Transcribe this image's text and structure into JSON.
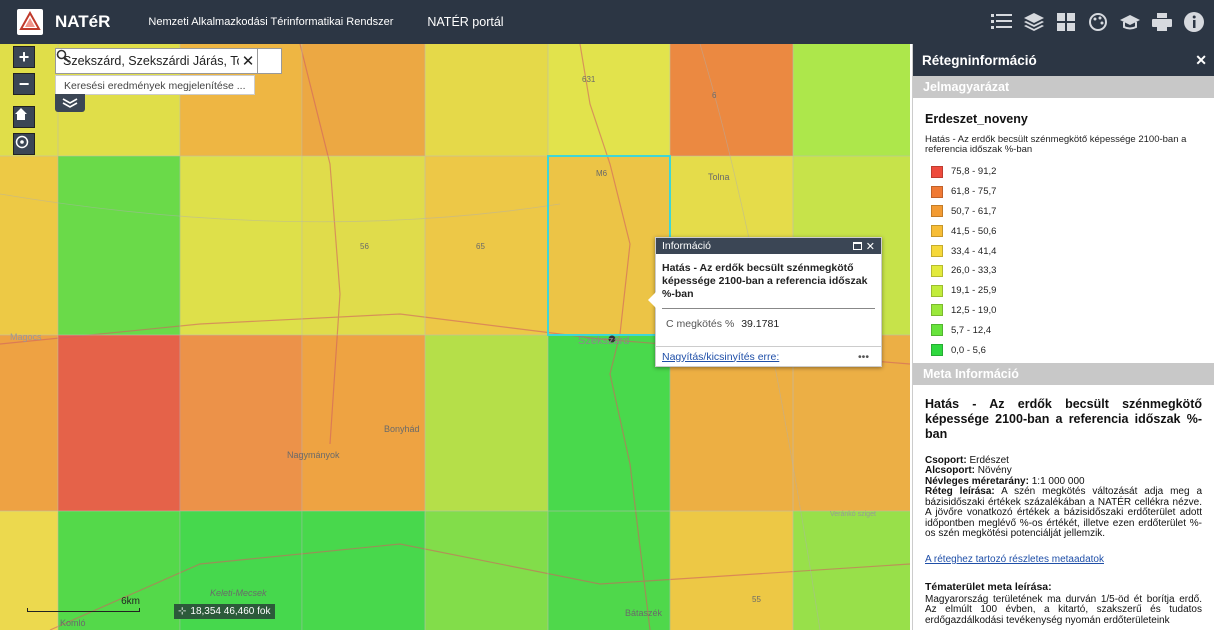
{
  "header": {
    "brand": "NATéR",
    "subtitle": "Nemzeti Alkalmazkodási Térinformatikai Rendszer",
    "portal_link": "NATÉR portál",
    "toolbar_icons": [
      "list-icon",
      "layers-icon",
      "grid-icon",
      "palette-icon",
      "graduation-cap-icon",
      "print-icon",
      "info-icon"
    ]
  },
  "map": {
    "search": {
      "value": "Szekszárd, Szekszárdi Járás, Tolna",
      "hint": "Keresési eredmények megjelenítése ..."
    },
    "place_labels": [
      "Szekszárd",
      "Tolna",
      "Bonyhád",
      "Nagymányok",
      "Bátaszék",
      "Komló",
      "Keleti-Mecsek",
      "Magocs",
      "Veránkó sziget"
    ],
    "road_labels": [
      "631",
      "6",
      "M6",
      "65",
      "56",
      "55"
    ],
    "scale_label": "6km",
    "coordinates": "18,354 46,460 fok",
    "grid_colors": [
      [
        "#e3de3a",
        "#f2b033",
        "#f0a033",
        "#e8d83a",
        "#e5e43d",
        "#ef7d31",
        "#a8e83c"
      ],
      [
        "#f1c635",
        "#5cd93a",
        "#e0e03b",
        "#e2dc3c",
        "#f1c538",
        "#f0c037",
        "#e8dc3b",
        "#c6e43b"
      ],
      [
        "#f39a33",
        "#e8513a",
        "#f0883a",
        "#f29b32",
        "#b2df3a",
        "#37d83e",
        "#f1a933",
        "#f0a936"
      ],
      [
        "#f0d840",
        "#43d83b",
        "#33d73f",
        "#35d73e",
        "#77dd3b",
        "#3ed73c",
        "#f1c535",
        "#91e03b"
      ]
    ]
  },
  "popup": {
    "header": "Információ",
    "title": "Hatás - Az erdők becsült szénmegkötő képessége 2100-ban a referencia időszak %-ban",
    "field_label": "C megkötés %",
    "field_value": "39.1781",
    "zoom_link": "Nagyítás/kicsinyítés erre:",
    "more": "•••"
  },
  "panel": {
    "title": "Rétegninformáció",
    "legend_section": "Jelmagyarázat",
    "layer_name": "Erdeszet_noveny",
    "legend_desc": "Hatás - Az erdők becsült szénmegkötő képessége 2100-ban a referencia időszak %-ban",
    "legend": [
      {
        "label": "75,8 - 91,2",
        "color": "#ee4b3d"
      },
      {
        "label": "61,8 - 75,7",
        "color": "#f07a35"
      },
      {
        "label": "50,7 - 61,7",
        "color": "#f39b33"
      },
      {
        "label": "41,5 - 50,6",
        "color": "#f7bd36"
      },
      {
        "label": "33,4 - 41,4",
        "color": "#f6d83a"
      },
      {
        "label": "26,0 - 33,3",
        "color": "#e3ea3c"
      },
      {
        "label": "19,1 - 25,9",
        "color": "#c2ec3b"
      },
      {
        "label": "12,5 - 19,0",
        "color": "#9ae83b"
      },
      {
        "label": "5,7 - 12,4",
        "color": "#67e33c"
      },
      {
        "label": "0,0 - 5,6",
        "color": "#2fd83f"
      }
    ],
    "meta_section": "Meta Információ",
    "meta_title": "Hatás - Az erdők becsült szénmegkötő képessége 2100-ban a referencia időszak %-ban",
    "csoport_label": "Csoport:",
    "csoport": "Erdészet",
    "alcsoport_label": "Alcsoport:",
    "alcsoport": "Növény",
    "meretarany_label": "Névleges méretarány:",
    "meretarany": "1:1 000 000",
    "leiras_label": "Réteg leírása:",
    "leiras": "A szén megkötés változását adja meg a bázisidőszaki értékek százalékában a NATÉR cellékra nézve. A jövőre vonatkozó értékek a bázisidőszaki erdőterület adott időpontben meglévő %-os értékét, illetve ezen erdőterület %-os szén megkötési potenciálját jellemzik.",
    "metadata_link": "A réteghez tartozó részletes metaadatok",
    "tema_title": "Tématerület meta leírása:",
    "tema_text": "Magyarország területének ma durván 1/5-öd ét borítja erdő. Az elmúlt 100 évben, a kitartó, szakszerű és tudatos erdőgazdálkodási tevékenység nyomán erdőterületeink"
  }
}
